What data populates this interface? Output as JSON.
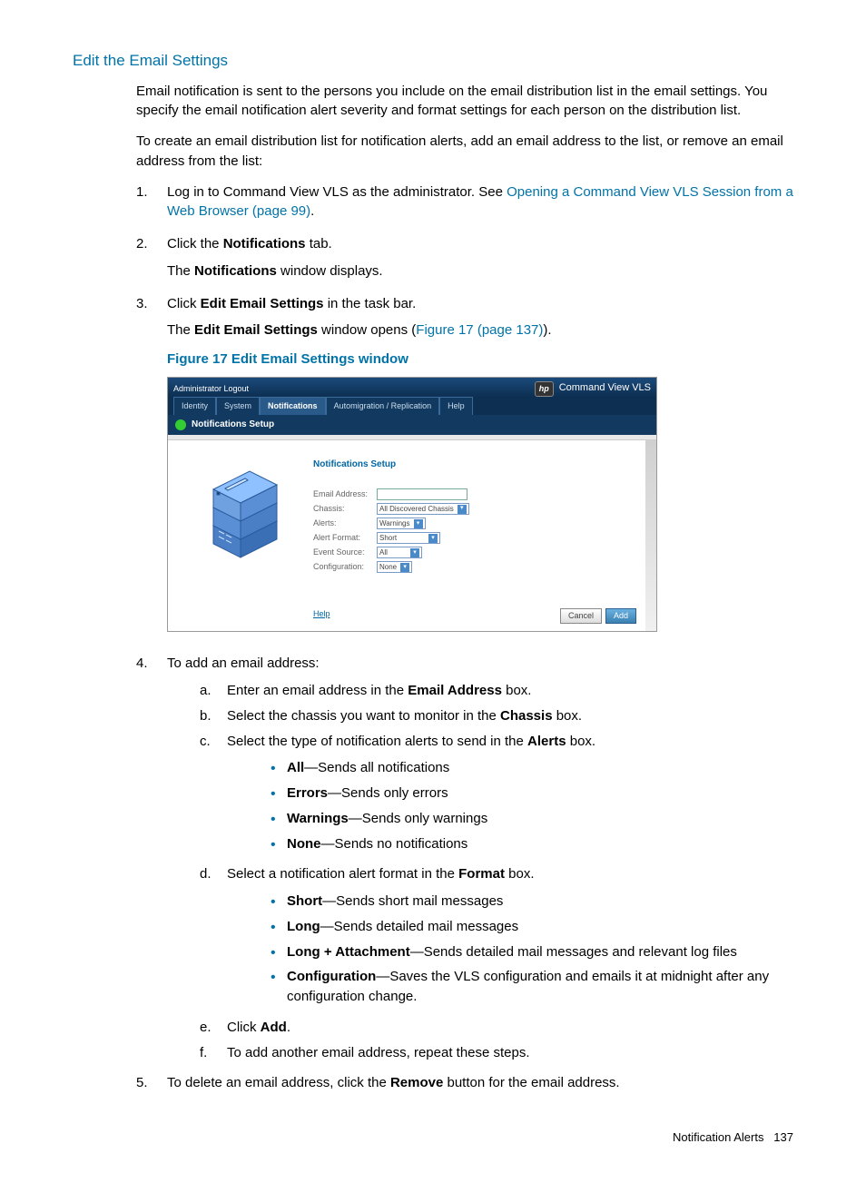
{
  "heading": "Edit the Email Settings",
  "intro1": "Email notification is sent to the persons you include on the email distribution list in the email settings. You specify the email notification alert severity and format settings for each person on the distribution list.",
  "intro2": "To create an email distribution list for notification alerts, add an email address to the list, or remove an email address from the list:",
  "steps": {
    "s1_a": "Log in to Command View VLS as the administrator. See ",
    "s1_link": "Opening a Command View VLS Session from a Web Browser (page 99)",
    "s1_b": ".",
    "s2_a": "Click the ",
    "s2_bold": "Notifications",
    "s2_b": " tab.",
    "s2_c1": "The ",
    "s2_c2": "Notifications",
    "s2_c3": " window displays.",
    "s3_a": "Click ",
    "s3_bold": "Edit Email Settings",
    "s3_b": " in the task bar.",
    "s3_c1": "The ",
    "s3_c2": "Edit Email Settings",
    "s3_c3": " window opens (",
    "s3_link": "Figure 17 (page 137)",
    "s3_c4": ").",
    "fig_caption": "Figure 17 Edit Email Settings window",
    "s4": "To add an email address:",
    "s4a_a": "Enter an email address in the ",
    "s4a_bold": "Email Address",
    "s4a_b": " box.",
    "s4b_a": "Select the chassis you want to monitor in the ",
    "s4b_bold": "Chassis",
    "s4b_b": " box.",
    "s4c_a": "Select the type of notification alerts to send in the ",
    "s4c_bold": "Alerts",
    "s4c_b": " box.",
    "b1a": "All",
    "b1b": "—Sends all notifications",
    "b2a": "Errors",
    "b2b": "—Sends only errors",
    "b3a": "Warnings",
    "b3b": "—Sends only warnings",
    "b4a": "None",
    "b4b": "—Sends no notifications",
    "s4d_a": "Select a notification alert format in the ",
    "s4d_bold": "Format",
    "s4d_b": " box.",
    "f1a": "Short",
    "f1b": "—Sends short mail messages",
    "f2a": "Long",
    "f2b": "—Sends detailed mail messages",
    "f3a": "Long + Attachment",
    "f3b": "—Sends detailed mail messages and relevant log files",
    "f4a": "Configuration",
    "f4b": "—Saves the VLS configuration and emails it at midnight after any configuration change.",
    "s4e_a": "Click ",
    "s4e_bold": "Add",
    "s4e_b": ".",
    "s4f": "To add another email address, repeat these steps.",
    "s5_a": "To delete an email address, click the ",
    "s5_bold": "Remove",
    "s5_b": " button for the email address."
  },
  "figure": {
    "user": "Administrator",
    "logout": "Logout",
    "brand": "Command View VLS",
    "hp_logo": "hp",
    "tabs": [
      "Identity",
      "System",
      "Notifications",
      "Automigration / Replication",
      "Help"
    ],
    "active_tab": 2,
    "bar_title": "Notifications Setup",
    "form_title": "Notifications Setup",
    "labels": {
      "email": "Email Address:",
      "chassis": "Chassis:",
      "alerts": "Alerts:",
      "format": "Alert Format:",
      "source": "Event Source:",
      "config": "Configuration:"
    },
    "values": {
      "chassis": "All Discovered Chassis",
      "alerts": "Warnings",
      "format": "Short",
      "source": "All",
      "config": "None"
    },
    "help": "Help",
    "cancel": "Cancel",
    "add": "Add"
  },
  "footer": {
    "section": "Notification Alerts",
    "page": "137"
  }
}
